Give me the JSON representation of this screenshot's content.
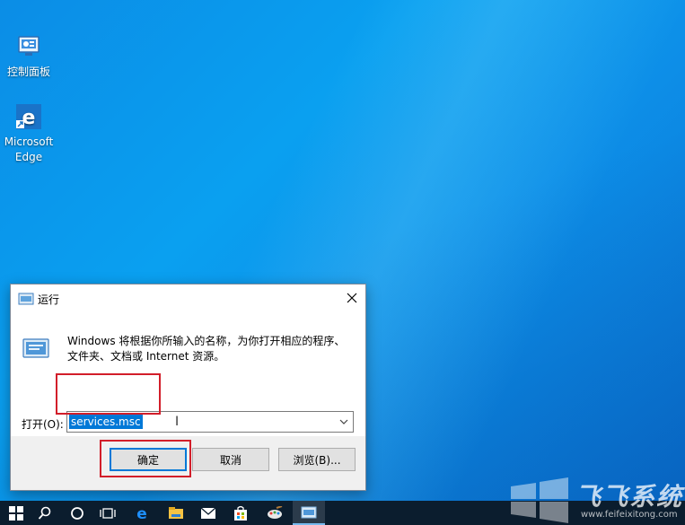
{
  "desktop": {
    "icons": [
      {
        "label": "控制面板"
      },
      {
        "label": "Microsoft Edge"
      }
    ]
  },
  "dialog": {
    "title": "运行",
    "description": "Windows 将根据你所输入的名称，为你打开相应的程序、文件夹、文档或 Internet 资源。",
    "open_label": "打开(O):",
    "input_value": "services.msc",
    "buttons": {
      "ok": "确定",
      "cancel": "取消",
      "browse": "浏览(B)..."
    }
  },
  "taskbar": {
    "items": [
      "start-icon",
      "search-icon",
      "cortana-icon",
      "task-view-icon",
      "edge-icon",
      "file-explorer-icon",
      "mail-icon",
      "store-icon",
      "paint-icon",
      "run-icon"
    ]
  },
  "watermark": {
    "text": "飞飞系统",
    "url": "www.feifeixitong.com"
  },
  "colors": {
    "highlight": "#d21e2a",
    "selection": "#0078d7"
  }
}
